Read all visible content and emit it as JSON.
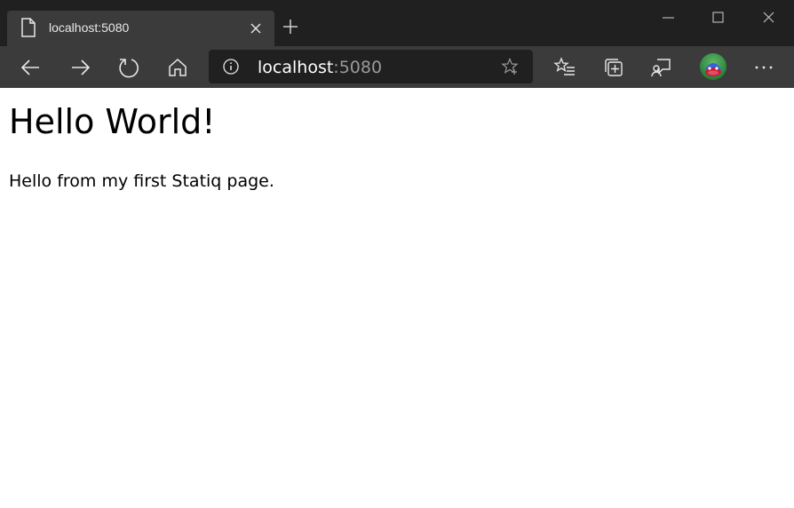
{
  "browser": {
    "tab": {
      "title": "localhost:5080",
      "icon": "page-icon",
      "close_icon": "close-icon"
    },
    "new_tab_icon": "plus-icon",
    "window_controls": [
      "minimize-icon",
      "maximize-icon",
      "close-icon"
    ],
    "toolbar": {
      "buttons": [
        "back-arrow-icon",
        "forward-arrow-icon",
        "refresh-icon",
        "home-icon",
        "favorites-icon",
        "collections-icon",
        "feedback-icon",
        "more-icon"
      ],
      "address": {
        "host": "localhost",
        "port": ":5080",
        "info_icon": "info-icon",
        "star_icon": "star-add-icon"
      },
      "avatar": "profile-avatar"
    },
    "colors": {
      "tabstrip_bg": "#202020",
      "toolbar_bg": "#3b3b3b",
      "addressbar_bg": "#202020",
      "page_bg": "#ffffff"
    }
  },
  "page": {
    "heading": "Hello World!",
    "paragraph": "Hello from my first Statiq page."
  }
}
